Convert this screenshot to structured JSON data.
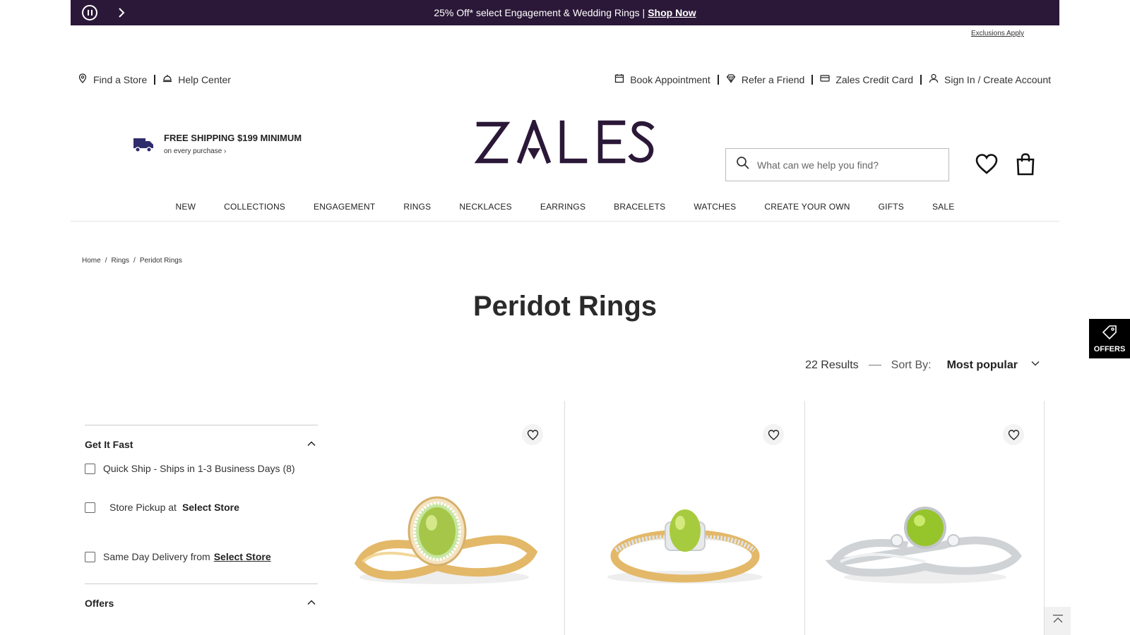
{
  "promo": {
    "text": "25% Off* select Engagement & Wedding Rings |",
    "link": "Shop Now",
    "exclusions": "Exclusions Apply"
  },
  "utility": {
    "left": [
      {
        "label": "Find a Store",
        "icon": "location-pin-icon"
      },
      {
        "label": "Help Center",
        "icon": "service-bell-icon"
      }
    ],
    "right": [
      {
        "label": "Book Appointment",
        "icon": "calendar-icon"
      },
      {
        "label": "Refer a Friend",
        "icon": "diamond-icon"
      },
      {
        "label": "Zales Credit Card",
        "icon": "credit-card-icon"
      },
      {
        "label": "Sign In / Create Account",
        "icon": "user-icon"
      }
    ]
  },
  "shipping": {
    "title": "FREE SHIPPING $199 MINIMUM",
    "subtitle": "on every purchase ›"
  },
  "logo": {
    "text": "ZALES",
    "color": "#2b1838"
  },
  "search": {
    "placeholder": "What can we help you find?"
  },
  "nav": [
    "NEW",
    "COLLECTIONS",
    "ENGAGEMENT",
    "RINGS",
    "NECKLACES",
    "EARRINGS",
    "BRACELETS",
    "WATCHES",
    "CREATE YOUR OWN",
    "GIFTS",
    "SALE"
  ],
  "breadcrumb": [
    "Home",
    "Rings",
    "Peridot Rings"
  ],
  "page_title": "Peridot Rings",
  "results": {
    "count": "22 Results",
    "sort_label": "Sort By:",
    "sort_value": "Most popular"
  },
  "offers_tab": "OFFERS",
  "filters": {
    "get_it_fast": {
      "title": "Get It Fast",
      "quick_ship": "Quick Ship - Ships in 1-3 Business Days (8)",
      "store_pickup": "Store Pickup at",
      "store_pickup_link": "Select Store",
      "same_day": "Same Day Delivery from",
      "same_day_link": "Select Store"
    },
    "offers": {
      "title": "Offers"
    }
  },
  "colors": {
    "brand": "#2b1838",
    "peridot": "#9cc23a",
    "gold": "#e8c27a",
    "silver": "#d8dadc"
  }
}
